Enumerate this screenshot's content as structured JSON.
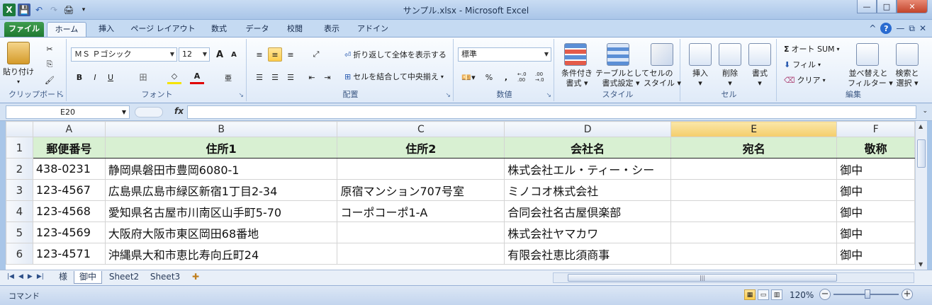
{
  "window": {
    "title": "サンプル.xlsx - Microsoft Excel"
  },
  "qat": {
    "app_icon": "X",
    "save_icon": "💾",
    "undo_icon": "↶",
    "redo_icon": "↷",
    "preview_icon": "🖨",
    "more_icon": "▾"
  },
  "window_buttons": {
    "minimize": "—",
    "maximize": "□",
    "close": "✕"
  },
  "tabs": [
    {
      "label": "ファイル"
    },
    {
      "label": "ホーム"
    },
    {
      "label": "挿入"
    },
    {
      "label": "ページ レイアウト"
    },
    {
      "label": "数式"
    },
    {
      "label": "データ"
    },
    {
      "label": "校閲"
    },
    {
      "label": "表示"
    },
    {
      "label": "アドイン"
    }
  ],
  "tabs_right": {
    "caret": "^",
    "help": "?",
    "minimize": "—",
    "restore": "⧉",
    "close": "✕"
  },
  "ribbon": {
    "clipboard": {
      "paste": "貼り付け",
      "label": "クリップボード"
    },
    "font": {
      "name": "ＭＳ Ｐゴシック",
      "size": "12",
      "grow": "A",
      "shrink": "A",
      "bold": "B",
      "italic": "I",
      "underline": "U",
      "border": "田",
      "fill": "◇",
      "color": "A",
      "phonetic": "亜",
      "label": "フォント"
    },
    "alignment": {
      "wrap": "折り返して全体を表示する",
      "merge": "セルを結合して中央揃え",
      "label": "配置"
    },
    "number": {
      "format": "標準",
      "percent": "%",
      "comma": ",",
      "inc": "←.0 .00",
      "dec": ".00 →.0",
      "label": "数値"
    },
    "styles": {
      "conditional": [
        "条件付き",
        "書式"
      ],
      "as_table": [
        "テーブルとして",
        "書式設定"
      ],
      "cell_styles": [
        "セルの",
        "スタイル"
      ],
      "label": "スタイル"
    },
    "cells": {
      "insert": "挿入",
      "delete": "削除",
      "format": "書式",
      "label": "セル"
    },
    "editing": {
      "autosum": "オート SUM",
      "fill": "フィル",
      "clear": "クリア",
      "sort": [
        "並べ替えと",
        "フィルター"
      ],
      "find": [
        "検索と",
        "選択"
      ],
      "label": "編集"
    }
  },
  "formula_bar": {
    "name_box": "E20",
    "fx": "fx",
    "formula": ""
  },
  "grid": {
    "columns": [
      "A",
      "B",
      "C",
      "D",
      "E",
      "F"
    ],
    "selected_column": "E",
    "rows": [
      {
        "num": "1",
        "cells": [
          "郵便番号",
          "住所1",
          "住所2",
          "会社名",
          "宛名",
          "敬称"
        ]
      },
      {
        "num": "2",
        "cells": [
          "438-0231",
          "静岡県磐田市豊岡6080-1",
          "",
          "株式会社エル・ティー・シー",
          "",
          "御中"
        ]
      },
      {
        "num": "3",
        "cells": [
          "123-4567",
          "広島県広島市緑区新宿1丁目2-34",
          "原宿マンション707号室",
          "ミノコオ株式会社",
          "",
          "御中"
        ]
      },
      {
        "num": "4",
        "cells": [
          "123-4568",
          "愛知県名古屋市川南区山手町5-70",
          "コーポコーポ1-A",
          "合同会社名古屋倶楽部",
          "",
          "御中"
        ]
      },
      {
        "num": "5",
        "cells": [
          "123-4569",
          "大阪府大阪市東区岡田68番地",
          "",
          "株式会社ヤマカワ",
          "",
          "御中"
        ]
      },
      {
        "num": "6",
        "cells": [
          "123-4571",
          "沖縄県大和市恵比寿向丘町24",
          "",
          "有限会社恵比須商事",
          "",
          "御中"
        ]
      }
    ]
  },
  "sheets": {
    "nav": [
      "|◀",
      "◀",
      "▶",
      "▶|"
    ],
    "tabs": [
      "様",
      "御中",
      "Sheet2",
      "Sheet3"
    ],
    "active": "御中",
    "new_sheet_icon": "✚"
  },
  "status": {
    "mode": "コマンド",
    "zoom": "120%",
    "zoom_level": 0.5
  },
  "colors": {
    "header_fill": "#d8f0d2",
    "selected_col": "#f4cd6b",
    "file_tab": "#1f7a32"
  }
}
